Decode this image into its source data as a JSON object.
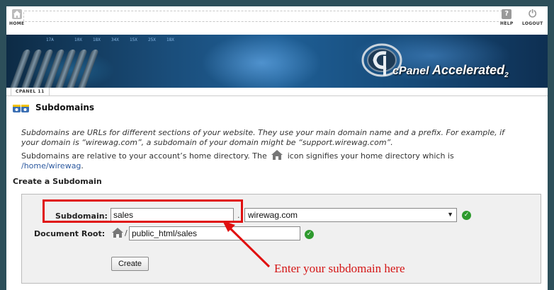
{
  "topnav": {
    "home_label": "HOME",
    "help_label": "HELP",
    "logout_label": "LOGOUT",
    "icons": {
      "home": "home-icon",
      "help": "help-icon",
      "logout": "logout-icon"
    }
  },
  "banner": {
    "brand_prefix": "cPanel",
    "brand_name": "Accelerated",
    "brand_suffix": "2",
    "grid_numbers": [
      "17A",
      "10X",
      "18X",
      "34X",
      "15X",
      "25X",
      "18X"
    ]
  },
  "breadcrumb": {
    "label": "CPANEL 11"
  },
  "page": {
    "title": "Subdomains",
    "desc_line1": "Subdomains are URLs for different sections of your website. They use your main domain name and a prefix. For example, if",
    "desc_line2": "your domain is “wirewag.com”, a subdomain of your domain might be “support.wirewag.com”.",
    "para_before_icon": "Subdomains are relative to your account’s home directory. The",
    "para_after_icon": "icon signifies your home directory which is",
    "home_dir": "/home/wirewag",
    "home_dir_suffix": "."
  },
  "form": {
    "section_title": "Create a Subdomain",
    "subdomain_label": "Subdomain:",
    "subdomain_value": "sales",
    "separator": ".",
    "domain_selected": "wirewag.com",
    "docroot_label": "Document Root:",
    "docroot_slash": "/",
    "docroot_value": "public_html/sales",
    "create_button": "Create"
  },
  "annotation": {
    "text": "Enter your subdomain here",
    "color": "#d41515"
  },
  "colors": {
    "background": "#2d4f5a",
    "accent_red": "#e01010",
    "ok_green": "#2e9a2e"
  }
}
